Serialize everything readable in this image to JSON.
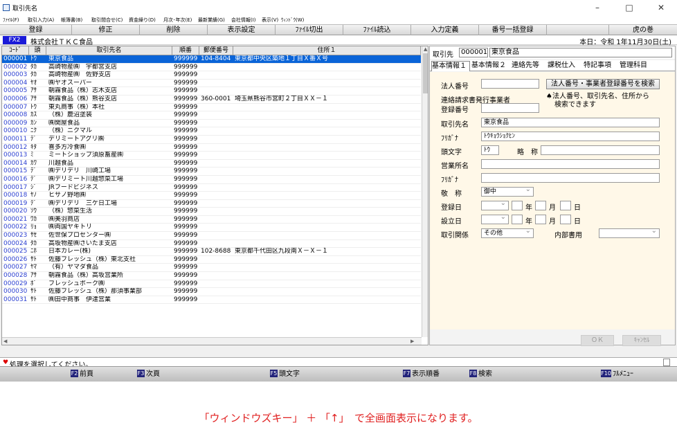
{
  "window": {
    "title": "取引先名",
    "controls": [
      "–",
      "□",
      "✕"
    ]
  },
  "menu": [
    "ﾌｧｲﾙ(F)",
    "取引入力(A)",
    "帳簿書(B)",
    "取引間合せ(C)",
    "資金繰り(D)",
    "月次･年次(E)",
    "最新業績(G)",
    "会社情報(I)",
    "表示(V)",
    "ｳｨﾝﾄﾞｳ(W)"
  ],
  "toolbar": [
    "登録",
    "修正",
    "削除",
    "表示設定",
    "ﾌｧｲﾙ切出",
    "ﾌｧｲﾙ読込",
    "入力定義",
    "番号一括登録",
    "",
    "虎の巻"
  ],
  "company": {
    "badge": "FX2",
    "name": "株式会社ＴＫＣ食品",
    "today": "本日：令和 1年11月30日(土)"
  },
  "grid": {
    "columns": [
      "ｺｰﾄﾞ",
      "頭",
      "取引先名",
      "順番",
      "郵便番号",
      "住所１"
    ],
    "selected_index": 0,
    "rows": [
      [
        "000001",
        "ﾄｳ",
        "東京食品",
        "999999",
        "104-8404",
        "東京都中央区築地１丁目Ｘ番Ｘ号"
      ],
      [
        "000002",
        "ﾀｶ",
        "高崎物産㈱　宇都宮支店",
        "999999",
        "",
        ""
      ],
      [
        "000003",
        "ﾀｶ",
        "高崎物産㈱　佐野支店",
        "999999",
        "",
        ""
      ],
      [
        "000004",
        "ﾔｵ",
        "㈱ヤオスーパー",
        "999999",
        "",
        ""
      ],
      [
        "000005",
        "ｱｻ",
        "朝霧食品（株）志木支店",
        "999999",
        "",
        ""
      ],
      [
        "000006",
        "ｱｻ",
        "朝霧食品（株）熊谷支店",
        "999999",
        "360-0001",
        "埼玉県熊谷市宮町２丁目ＸＸ－１"
      ],
      [
        "000007",
        "ﾄｳ",
        "東丸商事（株）本社",
        "999999",
        "",
        ""
      ],
      [
        "000008",
        "ｶｽ",
        "（株）鹿沼塗装",
        "999999",
        "",
        ""
      ],
      [
        "000009",
        "ｶﾝ",
        "㈱関屋食品",
        "999999",
        "",
        ""
      ],
      [
        "000010",
        "ﾆｸ",
        "（株）ニクマル",
        "999999",
        "",
        ""
      ],
      [
        "000011",
        "ﾃﾞ",
        "デリミートアグリ㈱",
        "999999",
        "",
        ""
      ],
      [
        "000012",
        "ｷﾀ",
        "喜多方冷食㈱",
        "999999",
        "",
        ""
      ],
      [
        "000013",
        "ﾐ",
        "ミートショップ須原畜産㈱",
        "999999",
        "",
        ""
      ],
      [
        "000014",
        "ｶﾜ",
        "川越食品",
        "999999",
        "",
        ""
      ],
      [
        "000015",
        "ﾃﾞ",
        "㈱デリデリ　川崎工場",
        "999999",
        "",
        ""
      ],
      [
        "000016",
        "ﾃﾞ",
        "㈱デリミート川越惣菜工場",
        "999999",
        "",
        ""
      ],
      [
        "000017",
        "ｼﾞ",
        "JRフードビジネス",
        "999999",
        "",
        ""
      ],
      [
        "000018",
        "ﾔﾉ",
        "ヒサノ野地㈱",
        "999999",
        "",
        ""
      ],
      [
        "000019",
        "ﾃﾞ",
        "㈱デリデリ　三ケ日工場",
        "999999",
        "",
        ""
      ],
      [
        "000020",
        "ｿｳ",
        "（株）惣菜生活",
        "999999",
        "",
        ""
      ],
      [
        "000021",
        "ﾜｶ",
        "㈱美羽商店",
        "999999",
        "",
        ""
      ],
      [
        "000022",
        "ﾘｮ",
        "㈱両国ヤキトリ",
        "999999",
        "",
        ""
      ],
      [
        "000023",
        "ｻｾ",
        "佐世保プロセンター㈱",
        "999999",
        "",
        ""
      ],
      [
        "000024",
        "ﾀｶ",
        "高坂物産㈱さいたま支店",
        "999999",
        "",
        ""
      ],
      [
        "000025",
        "ﾆﾎ",
        "日本カレー(株)",
        "999999",
        "102-8688",
        "東京都千代田区九段南Ｘ－Ｘ－１"
      ],
      [
        "000026",
        "ｻﾄ",
        "佐藤フレッシュ（株）東北支社",
        "999999",
        "",
        ""
      ],
      [
        "000027",
        "ﾔﾏ",
        "（有）ヤマダ食品",
        "999999",
        "",
        ""
      ],
      [
        "000028",
        "ｱｻ",
        "朝霧食品（株）高坂営業所",
        "999999",
        "",
        ""
      ],
      [
        "000029",
        "ﾎﾞ",
        "フレッシュポーク㈱",
        "999999",
        "",
        ""
      ],
      [
        "000030",
        "ｻﾄ",
        "佐藤フレッシュ（株）那須事業部",
        "999999",
        "",
        ""
      ],
      [
        "000031",
        "ｻﾄ",
        "㈱田中商事　伊達営業",
        "999999",
        "",
        ""
      ]
    ]
  },
  "detail": {
    "header_label": "取引先",
    "code": "000001",
    "name": "東京食品",
    "tabs": [
      "基本情報１",
      "基本情報２",
      "連絡先等",
      "課税仕入",
      "特記事項",
      "管理科目"
    ],
    "fields": {
      "corp_no_label": "法人番号",
      "corp_no_value": "",
      "search_button": "法人番号・事業者登録番号を検索",
      "invoice_label_1": "連絡請求書発行事業者",
      "invoice_label_2": "登録番号",
      "note_1": "♠法人番号、取引先名、住所から",
      "note_2": "検索できます",
      "name_label": "取引先名",
      "name_value": "東京食品",
      "kana_label": "ﾌﾘｶﾞﾅ",
      "kana_value": "ﾄｳｷｮｳｼｮｸﾋﾝ",
      "initial_label": "頭文字",
      "initial_value": "ﾄｳ",
      "short_label": "略　称",
      "short_value": "",
      "branch_label": "営業所名",
      "branch_value": "",
      "kana2_label": "ﾌﾘｶﾞﾅ",
      "kana2_value": "",
      "honor_label": "敬　称",
      "honor_value": "御中",
      "reg_label": "登録日",
      "est_label": "設立日",
      "year": "年",
      "month": "月",
      "day": "日",
      "relation_label": "取引関係",
      "relation_value": "その他",
      "internal_label": "内部書用",
      "internal_value": ""
    },
    "ok_button": "ＯＫ",
    "cancel_button": "ｷｬﾝｾﾙ"
  },
  "status": {
    "icon": "♥",
    "message": "処理を選択してください。"
  },
  "fkeys": [
    {
      "key": "F2",
      "label": "前頁"
    },
    {
      "key": "F3",
      "label": "次頁"
    },
    {
      "key": "F5",
      "label": "頭文字"
    },
    {
      "key": "F7",
      "label": "表示順番"
    },
    {
      "key": "F8",
      "label": "検索"
    },
    {
      "key": "F10",
      "label": "ﾌﾙﾒﾆｭｰ"
    }
  ],
  "caption": "「ウィンドウズキー」 ＋ 「↑」　で全画面表示になります。"
}
